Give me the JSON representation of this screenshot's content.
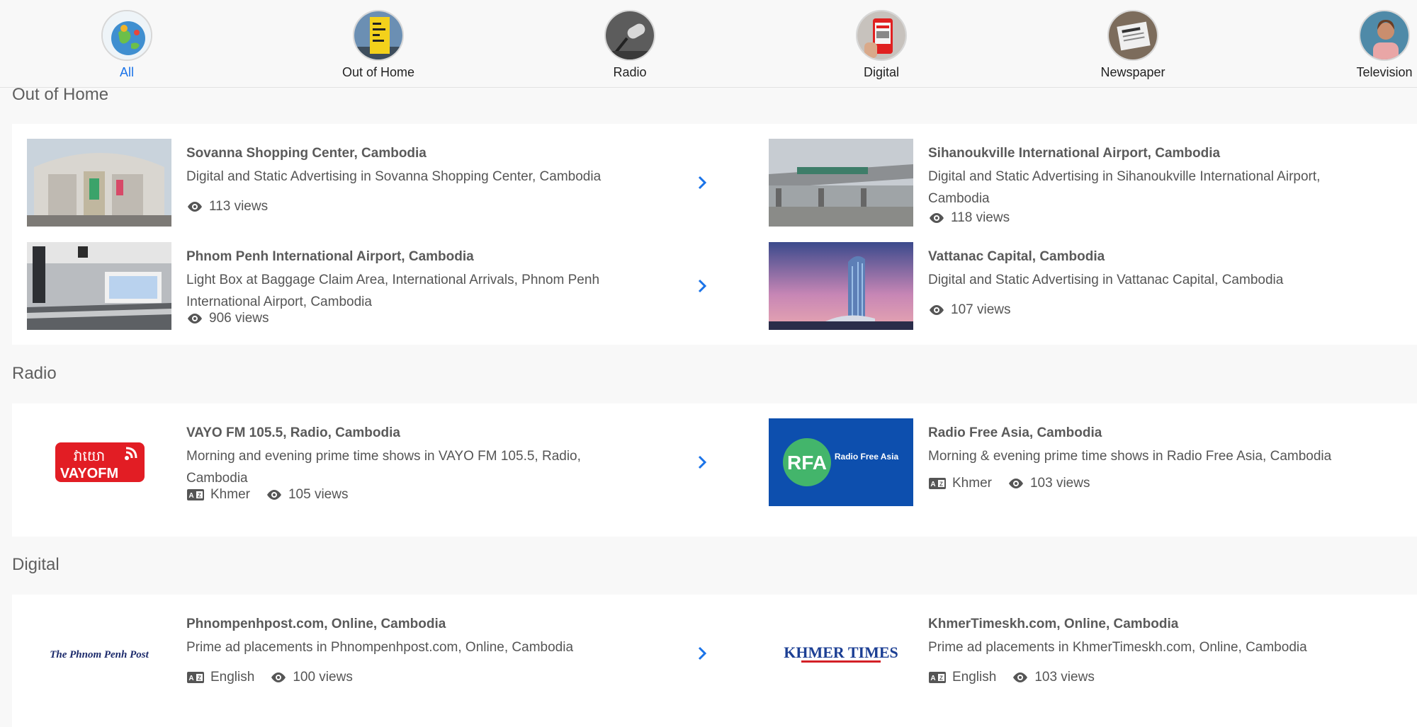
{
  "categories": [
    {
      "label": "All",
      "icon": "globe-icon"
    },
    {
      "label": "Out of Home",
      "icon": "billboard-icon"
    },
    {
      "label": "Radio",
      "icon": "microphone-icon"
    },
    {
      "label": "Digital",
      "icon": "smartphone-icon"
    },
    {
      "label": "Newspaper",
      "icon": "newspaper-icon"
    },
    {
      "label": "Television",
      "icon": "television-icon"
    }
  ],
  "active_category": "All",
  "accent_color": "#1a73e8",
  "sections": {
    "out_of_home": {
      "title": "Out of Home",
      "items": [
        {
          "title": "Sovanna Shopping Center, Cambodia",
          "desc": "Digital and Static Advertising in Sovanna Shopping Center, Cambodia",
          "views": "113 views"
        },
        {
          "title": "Sihanoukville International Airport, Cambodia",
          "desc": "Digital and Static Advertising in Sihanoukville International Airport, Cambodia",
          "views": "118 views"
        },
        {
          "title": "Phnom Penh International Airport, Cambodia",
          "desc": "Light Box at Baggage Claim Area, International Arrivals, Phnom Penh International Airport, Cambodia",
          "views": "906 views"
        },
        {
          "title": "Vattanac Capital, Cambodia",
          "desc": "Digital and Static Advertising in Vattanac Capital, Cambodia",
          "views": "107 views"
        }
      ]
    },
    "radio": {
      "title": "Radio",
      "items": [
        {
          "title": "VAYO FM 105.5, Radio, Cambodia",
          "desc": "Morning and evening prime time shows in VAYO FM 105.5, Radio, Cambodia",
          "language": "Khmer",
          "views": "105 views",
          "logo_text_top": "វាយោ",
          "logo_text_bottom": "VAYOFM"
        },
        {
          "title": "Radio Free Asia, Cambodia",
          "desc": "Morning & evening prime time shows in Radio Free Asia, Cambodia",
          "language": "Khmer",
          "views": "103 views",
          "logo_abbr": "RFA",
          "logo_text": "Radio Free Asia"
        }
      ]
    },
    "digital": {
      "title": "Digital",
      "items": [
        {
          "title": "Phnompenhpost.com, Online, Cambodia",
          "desc": "Prime ad placements in Phnompenhpost.com, Online, Cambodia",
          "language": "English",
          "views": "100 views",
          "logo_text": "The Phnom Penh Post"
        },
        {
          "title": "KhmerTimeskh.com, Online, Cambodia",
          "desc": "Prime ad placements in KhmerTimeskh.com, Online, Cambodia",
          "language": "English",
          "views": "103 views",
          "logo_text": "KHMER TIMES"
        }
      ]
    }
  }
}
